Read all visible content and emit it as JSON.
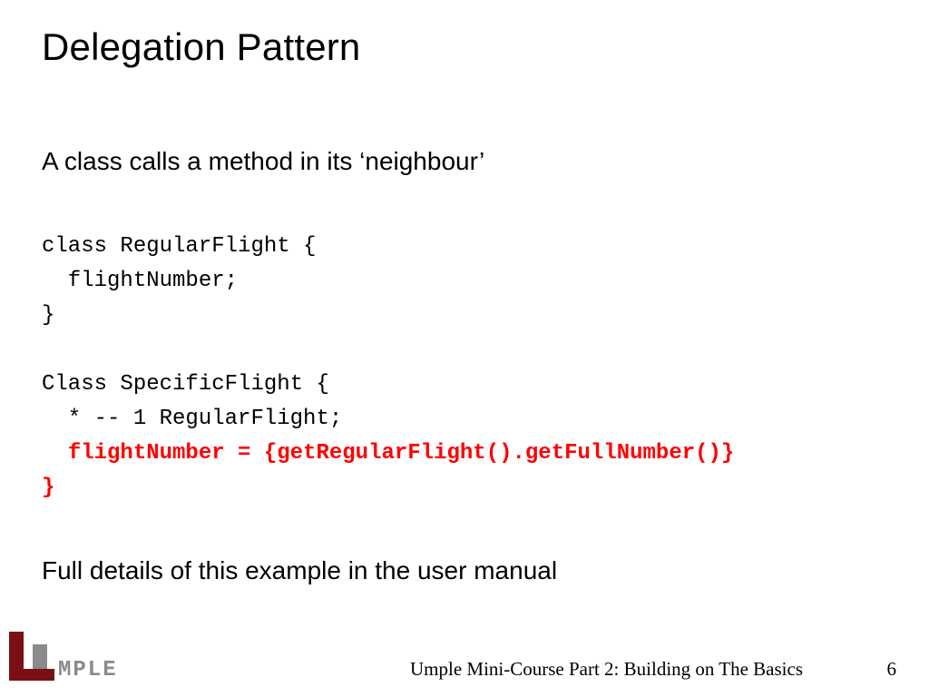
{
  "title": "Delegation Pattern",
  "lead": "A class calls a method in its ‘neighbour’",
  "code": {
    "l1": "class RegularFlight {",
    "l2": "  flightNumber;",
    "l3": "}",
    "l4": "",
    "l5": "Class SpecificFlight {",
    "l6": "  * -- 1 RegularFlight;",
    "l7_indent": "  ",
    "l7_red": "flightNumber = {getRegularFlight().getFullNumber()}",
    "l8_red": "}"
  },
  "closing": "Full details of this example in the user manual",
  "footer": {
    "course": "Umple Mini-Course Part 2: Building on The Basics",
    "page": "6",
    "logo_text": "MPLE"
  }
}
